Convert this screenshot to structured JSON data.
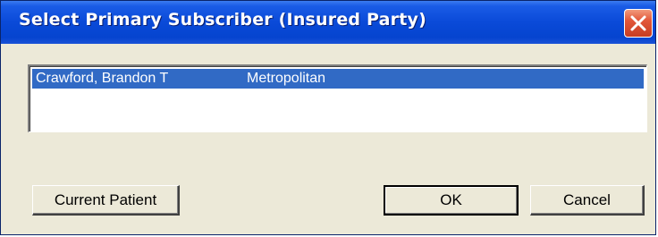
{
  "window": {
    "title": "Select Primary Subscriber (Insured Party)",
    "close_icon": "close-icon"
  },
  "subscriber_list": {
    "rows": [
      {
        "name": "Crawford, Brandon T",
        "carrier": "Metropolitan",
        "selected": true
      }
    ]
  },
  "buttons": {
    "current_patient": "Current Patient",
    "ok": "OK",
    "cancel": "Cancel"
  },
  "colors": {
    "title_bar": "#0a4ad8",
    "selection": "#316ac5",
    "dialog_face": "#ece9d8",
    "close_button": "#e2573a"
  }
}
